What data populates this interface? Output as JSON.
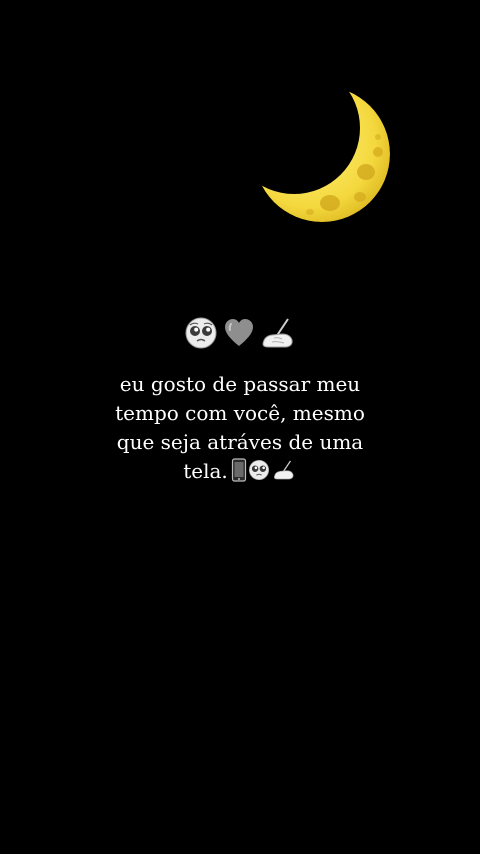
{
  "story": {
    "icons": {
      "moon": "crescent-moon-icon",
      "top_row": [
        "pleading-face-icon",
        "grey-heart-icon",
        "writing-hand-icon"
      ],
      "inline": [
        "mobile-phone-icon",
        "pleading-face-icon",
        "writing-hand-icon"
      ]
    },
    "caption_lines": [
      "eu gosto de passar meu",
      "tempo com você, mesmo",
      "que seja atráves de uma",
      "tela."
    ]
  },
  "colors": {
    "background": "#000000",
    "text": "#ffffff",
    "moon": "#f6dc4a"
  }
}
